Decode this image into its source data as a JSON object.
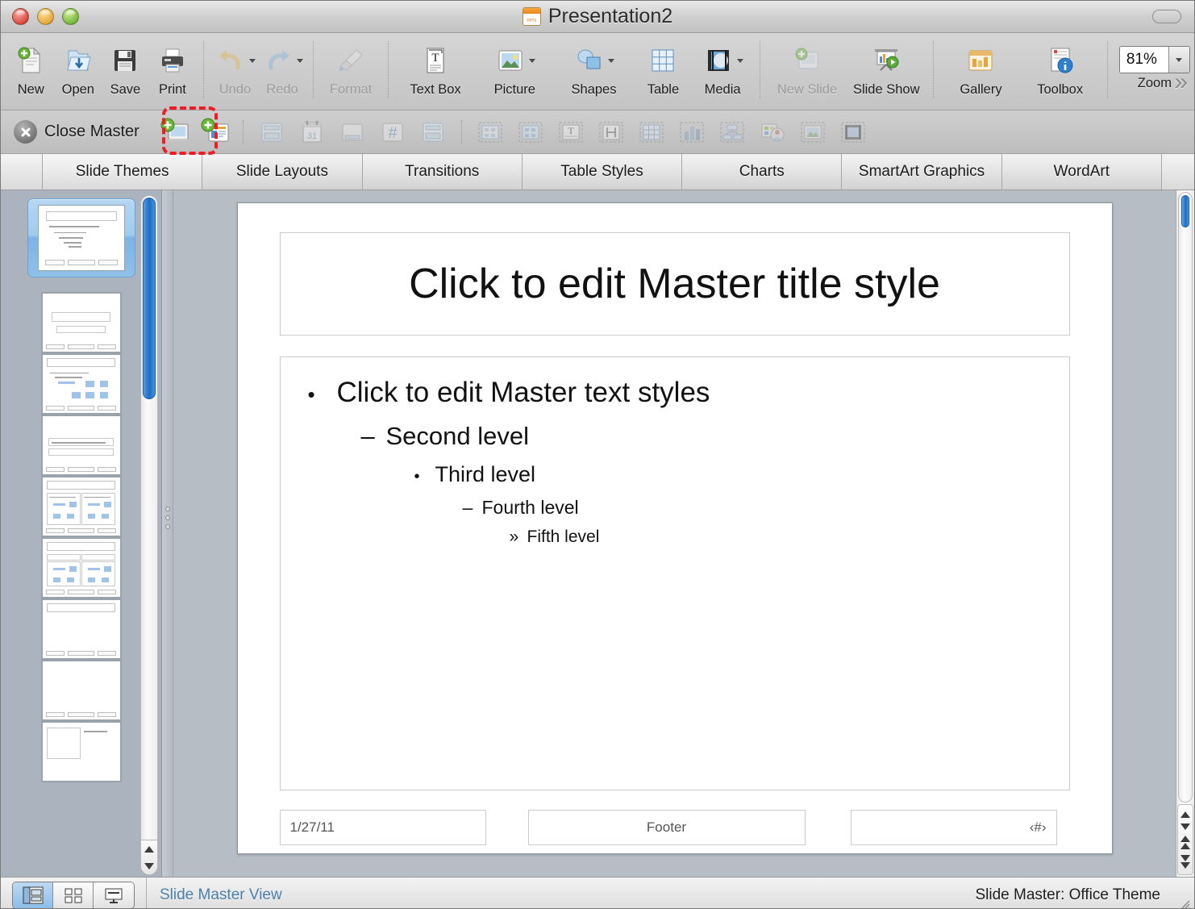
{
  "window": {
    "title": "Presentation2",
    "doc_icon": "powerpoint-document-icon",
    "controls": [
      "close",
      "minimize",
      "zoom"
    ]
  },
  "toolbar": {
    "items": [
      {
        "label": "New",
        "icon": "new-document-icon",
        "disabled": false,
        "caret": false
      },
      {
        "label": "Open",
        "icon": "open-folder-icon",
        "disabled": false,
        "caret": false
      },
      {
        "label": "Save",
        "icon": "save-floppy-icon",
        "disabled": false,
        "caret": false
      },
      {
        "label": "Print",
        "icon": "printer-icon",
        "disabled": false,
        "caret": false
      },
      {
        "label": "Undo",
        "icon": "undo-arrow-icon",
        "disabled": true,
        "caret": true
      },
      {
        "label": "Redo",
        "icon": "redo-arrow-icon",
        "disabled": true,
        "caret": true
      },
      {
        "label": "Format",
        "icon": "format-brush-icon",
        "disabled": true,
        "caret": false
      },
      {
        "label": "Text Box",
        "icon": "text-box-icon",
        "disabled": false,
        "caret": false
      },
      {
        "label": "Picture",
        "icon": "picture-icon",
        "disabled": false,
        "caret": true
      },
      {
        "label": "Shapes",
        "icon": "shapes-icon",
        "disabled": false,
        "caret": true
      },
      {
        "label": "Table",
        "icon": "table-grid-icon",
        "disabled": false,
        "caret": false
      },
      {
        "label": "Media",
        "icon": "media-icon",
        "disabled": false,
        "caret": true
      },
      {
        "label": "New Slide",
        "icon": "new-slide-icon",
        "disabled": true,
        "caret": false
      },
      {
        "label": "Slide Show",
        "icon": "slide-show-icon",
        "disabled": false,
        "caret": false
      },
      {
        "label": "Gallery",
        "icon": "gallery-icon",
        "disabled": false,
        "caret": false
      },
      {
        "label": "Toolbox",
        "icon": "toolbox-icon",
        "disabled": false,
        "caret": false
      }
    ],
    "zoom": {
      "label": "Zoom",
      "value": "81%"
    },
    "overflow": "overflow-chevrons-icon"
  },
  "master_bar": {
    "close_label": "Close Master",
    "close_icon": "close-circle-x-icon",
    "buttons": [
      {
        "name": "new-master-icon",
        "disabled": false
      },
      {
        "name": "new-layout-icon",
        "disabled": false
      },
      {
        "name": "master-layout-icon",
        "disabled": true
      },
      {
        "name": "insert-date-icon",
        "disabled": true
      },
      {
        "name": "insert-footer-icon",
        "disabled": true
      },
      {
        "name": "insert-slide-number-icon",
        "disabled": true
      },
      {
        "name": "master-placeholder-icon",
        "disabled": true
      },
      {
        "name": "content-placeholder-icon",
        "disabled": true
      },
      {
        "name": "content-grid-icon",
        "disabled": true
      },
      {
        "name": "text-placeholder-icon",
        "disabled": true
      },
      {
        "name": "vertical-text-icon",
        "disabled": true
      },
      {
        "name": "table-placeholder-icon",
        "disabled": true
      },
      {
        "name": "chart-placeholder-icon",
        "disabled": true
      },
      {
        "name": "smartart-placeholder-icon",
        "disabled": true
      },
      {
        "name": "clipart-placeholder-icon",
        "disabled": true
      },
      {
        "name": "picture-placeholder-icon",
        "disabled": true
      },
      {
        "name": "media-placeholder-icon",
        "disabled": true
      }
    ],
    "annotation": "red-dashed-highlight-new-master"
  },
  "elements_gallery": {
    "tabs": [
      {
        "label": "Slide Themes",
        "active": true
      },
      {
        "label": "Slide Layouts",
        "active": false
      },
      {
        "label": "Transitions",
        "active": false
      },
      {
        "label": "Table Styles",
        "active": false
      },
      {
        "label": "Charts",
        "active": false
      },
      {
        "label": "SmartArt Graphics",
        "active": false
      },
      {
        "label": "WordArt",
        "active": false
      }
    ]
  },
  "thumbnails": {
    "selected_index": 0,
    "count": 9,
    "items": [
      {
        "kind": "master",
        "selected": true
      },
      {
        "kind": "title",
        "selected": false
      },
      {
        "kind": "content",
        "selected": false
      },
      {
        "kind": "section",
        "selected": false
      },
      {
        "kind": "two-content",
        "selected": false
      },
      {
        "kind": "comparison",
        "selected": false
      },
      {
        "kind": "title-only",
        "selected": false
      },
      {
        "kind": "blank",
        "selected": false
      },
      {
        "kind": "caption",
        "selected": false
      }
    ]
  },
  "slide": {
    "title": "Click to edit Master title style",
    "body_levels": [
      {
        "bullet": "•",
        "text": "Click to edit Master text styles"
      },
      {
        "bullet": "–",
        "text": "Second level"
      },
      {
        "bullet": "•",
        "text": "Third level"
      },
      {
        "bullet": "–",
        "text": "Fourth level"
      },
      {
        "bullet": "»",
        "text": "Fifth level"
      }
    ],
    "footers": {
      "date": "1/27/11",
      "footer": "Footer",
      "slide_number": "‹#›"
    }
  },
  "status_bar": {
    "view_buttons": [
      {
        "name": "normal-view-button",
        "active": true
      },
      {
        "name": "slide-sorter-view-button",
        "active": false
      },
      {
        "name": "presenter-view-button",
        "active": false
      }
    ],
    "left_text": "Slide Master View",
    "right_text": "Slide Master: Office Theme"
  },
  "colors": {
    "accent_blue": "#2f81d5",
    "annotation_red": "#ee1c25",
    "status_link": "#4a7fa8",
    "pane_bg": "#aab3be"
  }
}
